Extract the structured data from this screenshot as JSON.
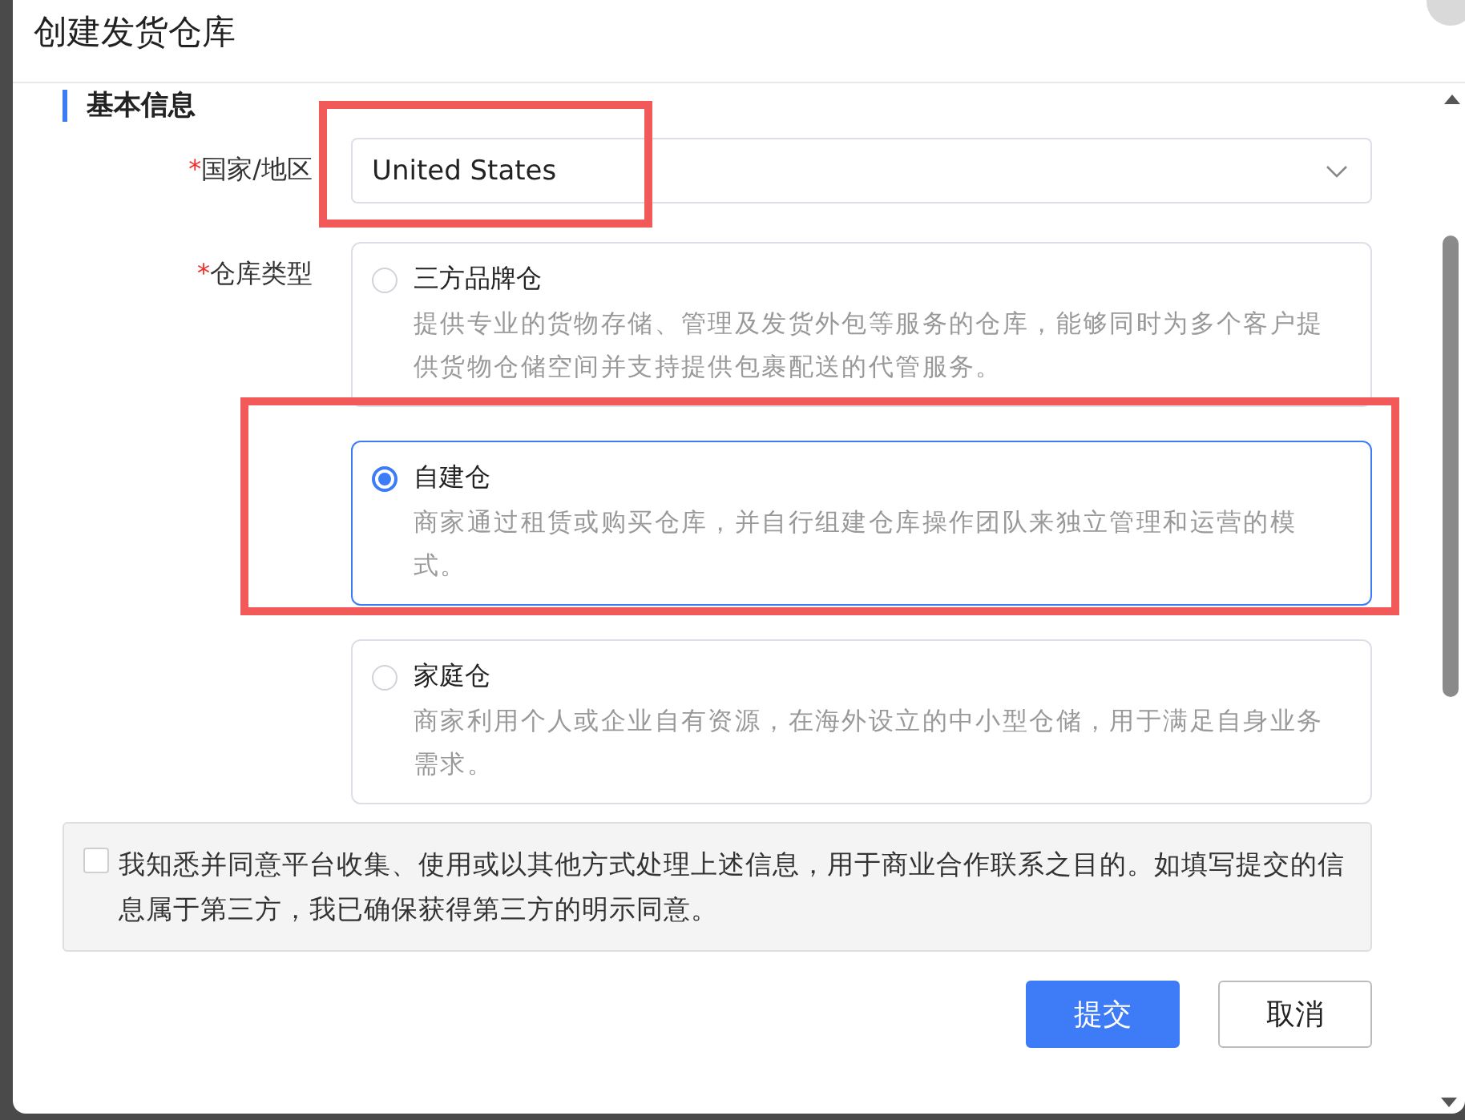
{
  "dialog": {
    "title": "创建发货仓库"
  },
  "section": {
    "title": "基本信息"
  },
  "fields": [
    {
      "kind": "select",
      "label": "国家/地区",
      "required_mark": "*",
      "value": "United States"
    },
    {
      "kind": "radio_group",
      "label": "仓库类型",
      "required_mark": "*",
      "options": [
        {
          "title": "三方品牌仓",
          "description": "提供专业的货物存储、管理及发货外包等服务的仓库，能够同时为多个客户提供货物仓储空间并支持提供包裹配送的代管服务。",
          "selected": false
        },
        {
          "title": "自建仓",
          "description": "商家通过租赁或购买仓库，并自行组建仓库操作团队来独立管理和运营的模式。",
          "selected": true
        },
        {
          "title": "家庭仓",
          "description": "商家利用个人或企业自有资源，在海外设立的中小型仓储，用于满足自身业务需求。",
          "selected": false
        }
      ]
    }
  ],
  "consent": {
    "checked": false,
    "text": "我知悉并同意平台收集、使用或以其他方式处理上述信息，用于商业合作联系之目的。如填写提交的信息属于第三方，我已确保获得第三方的明示同意。"
  },
  "buttons": [
    {
      "label": "提交",
      "kind": "primary"
    },
    {
      "label": "取消",
      "kind": "default"
    }
  ]
}
